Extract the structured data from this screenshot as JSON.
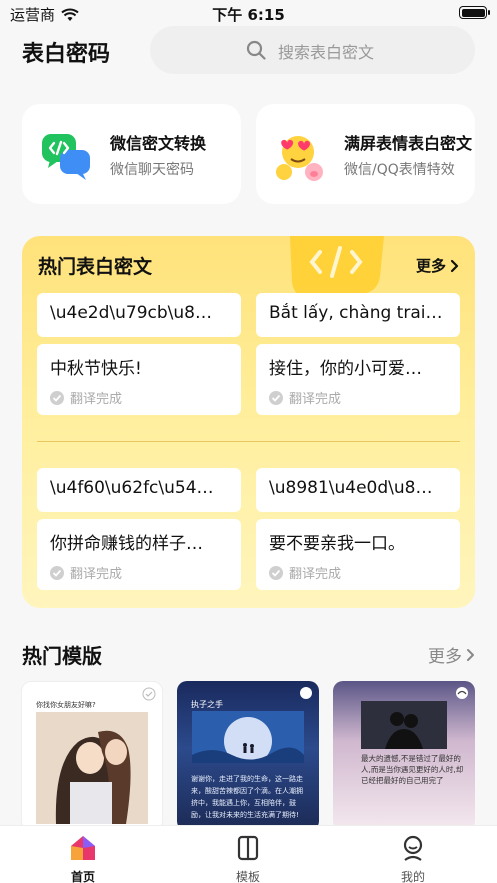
{
  "status_bar": {
    "carrier": "运营商",
    "time": "下午 6:15"
  },
  "header": {
    "title": "表白密码",
    "search_placeholder": "搜索表白密文"
  },
  "features": [
    {
      "title": "微信密文转换",
      "subtitle": "微信聊天密码",
      "icon": "wechat-code-icon"
    },
    {
      "title": "满屏表情表白密文",
      "subtitle": "微信/QQ表情特效",
      "icon": "emoji-hearts-icon"
    }
  ],
  "hot_ciphers": {
    "title": "热门表白密文",
    "more": "更多",
    "items": [
      {
        "cipher": "\\u4e2d\\u79cb\\u8…",
        "plain": "中秋节快乐!",
        "status": "翻译完成"
      },
      {
        "cipher": "Bắt lấy, chàng trai…",
        "plain": "接住，你的小可爱…",
        "status": "翻译完成"
      },
      {
        "cipher": "\\u4f60\\u62fc\\u54…",
        "plain": "你拼命赚钱的样子…",
        "status": "翻译完成"
      },
      {
        "cipher": "\\u8981\\u4e0d\\u8…",
        "plain": "要不要亲我一口。",
        "status": "翻译完成"
      }
    ]
  },
  "templates": {
    "title": "热门模版",
    "more": "更多",
    "items": [
      {
        "caption": "你找你女朋友好嘛?"
      },
      {
        "caption": "执子之手",
        "body": "谢谢你，走进了我的生命，这一路走来，酸甜苦辣都因了个滴。在人潮拥挤中，我能遇上你，互相陪伴，鼓励，让我对未来的生活充满了期待!"
      },
      {
        "caption": "最大的遗憾,不是错过了最好的人,而是当你遇见更好的人时,却已经把最好的自己用完了"
      }
    ]
  },
  "tabbar": {
    "items": [
      {
        "label": "首页"
      },
      {
        "label": "模板"
      },
      {
        "label": "我的"
      }
    ]
  },
  "colors": {
    "accent_yellow": "#ffe27a",
    "wechat_green": "#21c35e",
    "tab_active": "#e8376b"
  }
}
